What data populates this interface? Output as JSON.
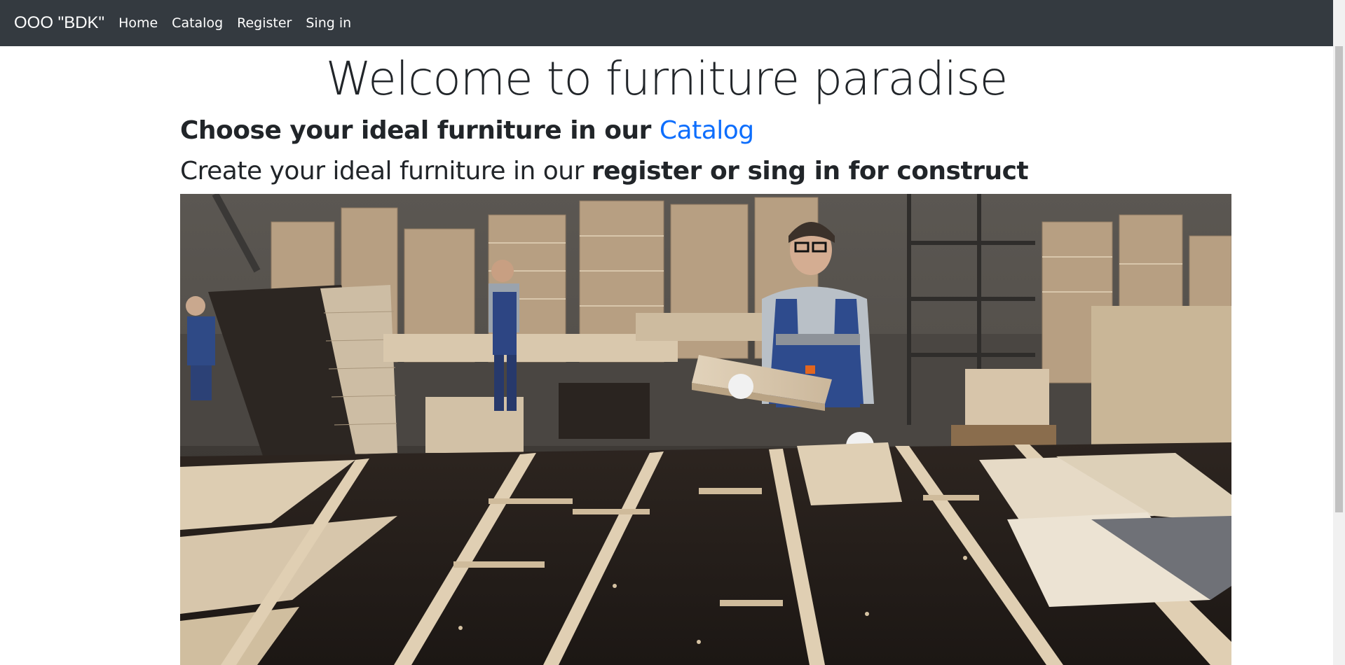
{
  "navbar": {
    "brand": "OOO \"BDK\"",
    "links": [
      {
        "label": "Home"
      },
      {
        "label": "Catalog"
      },
      {
        "label": "Register"
      },
      {
        "label": "Sing in"
      }
    ],
    "background": "#343a40"
  },
  "main": {
    "title": "Welcome to furniture paradise",
    "line1_prefix": "Choose your ideal furniture in our ",
    "line1_link": "Catalog",
    "line2_prefix": "Create your ideal furniture in our ",
    "line2_bold": "register or sing in for construct",
    "link_color": "#0d6efd"
  }
}
